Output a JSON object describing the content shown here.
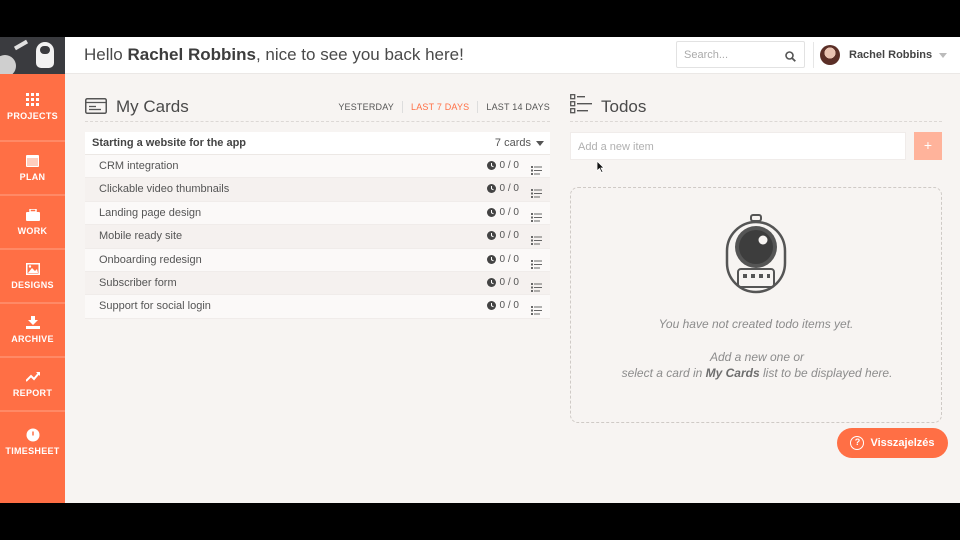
{
  "header": {
    "greeting_prefix": "Hello",
    "user_name": "Rachel Robbins",
    "greeting_suffix": ", nice to see you back here!",
    "search_placeholder": "Search...",
    "account_name": "Rachel Robbins"
  },
  "sidebar": {
    "items": [
      {
        "label": "PROJECTS",
        "icon": "grid-icon"
      },
      {
        "label": "PLAN",
        "icon": "calendar-icon"
      },
      {
        "label": "WORK",
        "icon": "briefcase-icon"
      },
      {
        "label": "DESIGNS",
        "icon": "image-icon"
      },
      {
        "label": "ARCHIVE",
        "icon": "download-icon"
      },
      {
        "label": "REPORT",
        "icon": "trend-icon"
      },
      {
        "label": "TIMESHEET",
        "icon": "clock-icon"
      }
    ]
  },
  "cards": {
    "title": "My Cards",
    "filters": [
      "YESTERDAY",
      "LAST 7 DAYS",
      "LAST 14 DAYS"
    ],
    "active_filter": "LAST 7 DAYS",
    "project": {
      "name": "Starting a website for the app",
      "count": "7 cards"
    },
    "rows": [
      {
        "name": "CRM integration",
        "time": "0 / 0"
      },
      {
        "name": "Clickable video thumbnails",
        "time": "0 / 0"
      },
      {
        "name": "Landing page design",
        "time": "0 / 0"
      },
      {
        "name": "Mobile ready site",
        "time": "0 / 0"
      },
      {
        "name": "Onboarding redesign",
        "time": "0 / 0"
      },
      {
        "name": "Subscriber form",
        "time": "0 / 0"
      },
      {
        "name": "Support for social login",
        "time": "0 / 0"
      }
    ]
  },
  "todos": {
    "title": "Todos",
    "input_placeholder": "Add a new item",
    "add_label": "+",
    "empty_message": "You have not created todo items yet.",
    "hint_line1": "Add a new one or",
    "hint_pre": "select a card in ",
    "hint_bold": "My Cards",
    "hint_post": " list to be displayed here."
  },
  "feedback": {
    "label": "Visszajelzés",
    "icon": "question-icon"
  },
  "colors": {
    "accent": "#ff6f45",
    "accent_light": "#ffb39b",
    "sidebar_logo_bg": "#3a3b3f"
  }
}
